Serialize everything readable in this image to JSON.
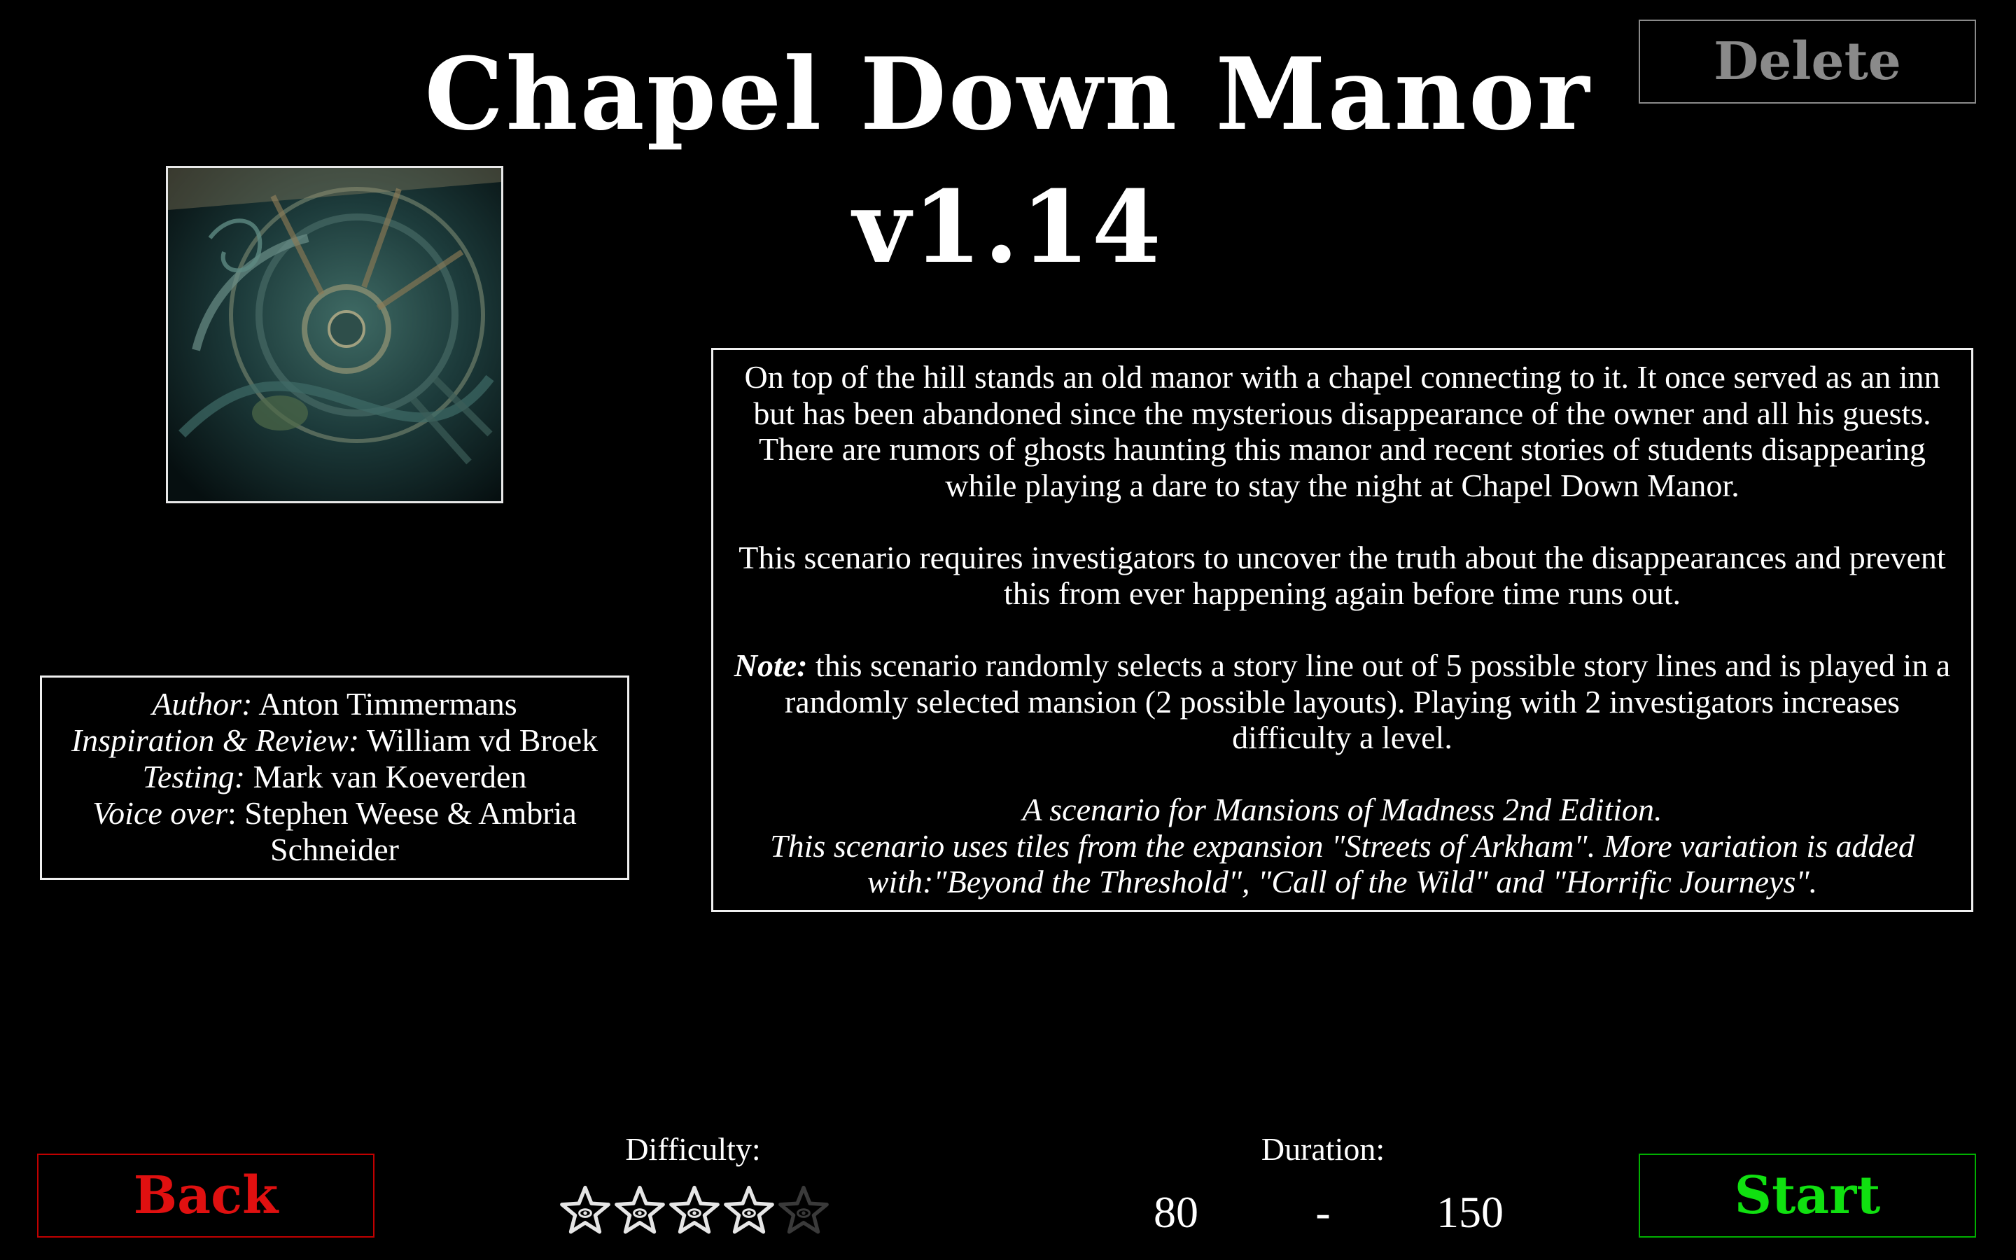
{
  "title": "Chapel Down Manor v1.14",
  "buttons": {
    "delete": "Delete",
    "back": "Back",
    "start": "Start"
  },
  "image": {
    "icon": "scenario-artwork"
  },
  "credits": {
    "author_label": "Author:",
    "author": " Anton Timmermans",
    "inspiration_label": "Inspiration & Review:",
    "inspiration": " William vd Broek",
    "testing_label": "Testing:",
    "testing": " Mark van Koeverden",
    "voice_label": "Voice over",
    "voice": ": Stephen Weese & Ambria Schneider"
  },
  "description": {
    "paragraph1": "On top of the hill stands an old manor with a chapel connecting to it. It once served as an inn but has been abandoned since the mysterious disappearance of the owner and all his guests. There are rumors of ghosts haunting this manor and recent stories of students disappearing while playing a dare to stay the night at Chapel Down Manor.",
    "paragraph2": "This scenario requires investigators to uncover the truth about the disappearances and prevent this from ever happening again before time runs out.",
    "note_label": "Note:",
    "note": " this scenario randomly selects a story line out of 5 possible story lines and is played in a randomly selected mansion (2 possible layouts). Playing with 2 investigators increases difficulty a level.",
    "italic_line1": "A scenario for Mansions of Madness 2nd Edition.",
    "italic_line2": "This scenario uses tiles from the expansion \"Streets of Arkham\". More variation is added with:\"Beyond the Threshold\", \"Call of the Wild\" and \"Horrific Journeys\"."
  },
  "difficulty": {
    "label": "Difficulty:",
    "rating": 4,
    "max": 5,
    "icon": "elder-sign-star-icon"
  },
  "duration": {
    "label": "Duration:",
    "min": "80",
    "separator": "-",
    "max": "150"
  },
  "colors": {
    "background": "#000000",
    "text": "#ffffff",
    "delete": "#8a8a8a",
    "back": "#e01010",
    "start": "#10e010",
    "star_active": "#e6e6e6",
    "star_inactive": "#3a3a3a"
  }
}
